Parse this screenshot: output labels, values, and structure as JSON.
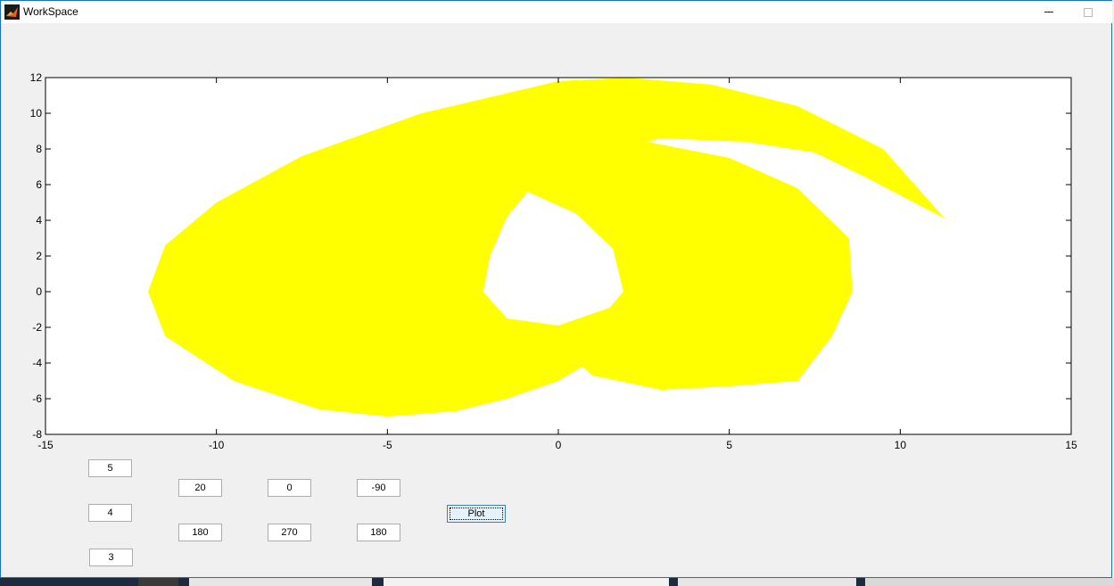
{
  "window": {
    "title": "WorkSpace"
  },
  "chart_data": {
    "type": "area",
    "title": "",
    "xlabel": "",
    "ylabel": "",
    "xlim": [
      -15,
      15
    ],
    "ylim": [
      -8,
      12
    ],
    "x_ticks": [
      "-15",
      "-10",
      "-5",
      "0",
      "5",
      "10",
      "15"
    ],
    "y_ticks": [
      "12",
      "10",
      "8",
      "6",
      "4",
      "2",
      "0",
      "-2",
      "-4",
      "-6",
      "-8"
    ],
    "fill_color": "#ffff00",
    "grid": false,
    "series": [
      {
        "outer_boundary": [
          [
            -12,
            0
          ],
          [
            -11.5,
            2.6
          ],
          [
            -10,
            5
          ],
          [
            -7.5,
            7.6
          ],
          [
            -4,
            10
          ],
          [
            0,
            11.8
          ],
          [
            2,
            12
          ],
          [
            4.5,
            11.6
          ],
          [
            7,
            10.4
          ],
          [
            9.5,
            8
          ],
          [
            11.3,
            4.1
          ],
          [
            11,
            4.4
          ],
          [
            9,
            6.4
          ],
          [
            7.5,
            7.8
          ],
          [
            5.5,
            8.4
          ],
          [
            3,
            8.6
          ],
          [
            2.6,
            8.4
          ],
          [
            5,
            7.5
          ],
          [
            7,
            5.8
          ],
          [
            8.5,
            3
          ],
          [
            8.6,
            0
          ],
          [
            8,
            -2.5
          ],
          [
            7,
            -5
          ],
          [
            5,
            -5.3
          ],
          [
            3,
            -5.5
          ],
          [
            1,
            -4.7
          ],
          [
            0.7,
            -4.2
          ],
          [
            0,
            -5
          ],
          [
            -1.5,
            -6
          ],
          [
            -3,
            -6.7
          ],
          [
            -5,
            -7
          ],
          [
            -7,
            -6.6
          ],
          [
            -9.5,
            -5
          ],
          [
            -11.5,
            -2.5
          ],
          [
            -12,
            0
          ]
        ],
        "hole": [
          [
            -0.9,
            5.6
          ],
          [
            0.5,
            4.4
          ],
          [
            1.6,
            2.4
          ],
          [
            1.9,
            0
          ],
          [
            1.5,
            -0.9
          ],
          [
            0,
            -1.9
          ],
          [
            -1.5,
            -1.5
          ],
          [
            -2.2,
            0
          ],
          [
            -2,
            2
          ],
          [
            -1.5,
            4.2
          ],
          [
            -0.9,
            5.6
          ]
        ]
      }
    ]
  },
  "controls": {
    "fields": [
      "5",
      "4",
      "3",
      "20",
      "180",
      "0",
      "270",
      "-90",
      "180"
    ],
    "plot_label": "Plot"
  }
}
